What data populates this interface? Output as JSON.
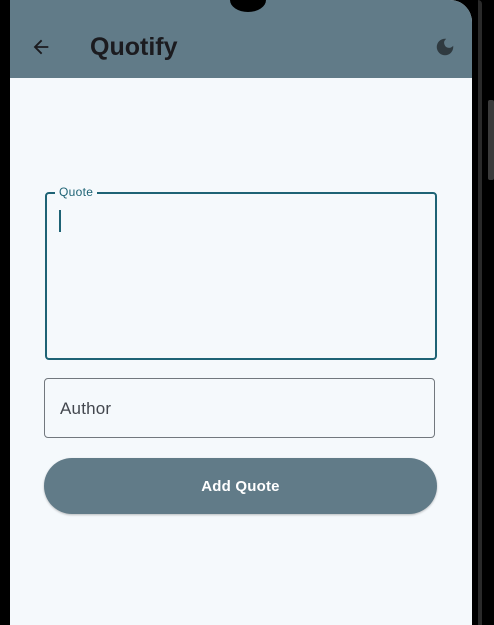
{
  "app": {
    "title": "Quotify"
  },
  "appbar": {
    "back_icon": "arrow-left-icon",
    "theme_icon": "moon-icon",
    "background": "#617b88"
  },
  "form": {
    "quote": {
      "label": "Quote",
      "value": ""
    },
    "author": {
      "placeholder": "Author",
      "value": ""
    },
    "submit_label": "Add Quote"
  },
  "colors": {
    "primary": "#1e6375",
    "surface": "#f5f9fc",
    "button": "#617b88",
    "outline": "#72787e"
  }
}
